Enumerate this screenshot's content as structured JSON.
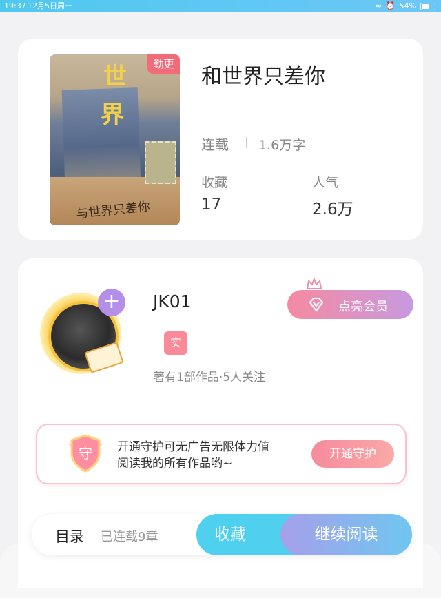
{
  "status_bar": {
    "time": "19:37",
    "date": "12月5日周一",
    "battery": "54%"
  },
  "book": {
    "badge": "勤更",
    "cover_lines": {
      "title_a": "世",
      "title_b": "界",
      "bottom_text": "与世界只差你"
    },
    "title": "和世界只差你",
    "status": "连载",
    "words": "1.6万字",
    "stats": [
      {
        "label": "收藏",
        "value": "17"
      },
      {
        "label": "人气",
        "value": "2.6万"
      }
    ]
  },
  "author": {
    "name": "JK01",
    "verify_badge": "实",
    "meta": "著有1部作品·5人关注",
    "vip_button": "点亮会员"
  },
  "guard": {
    "shield_char": "守",
    "line1": "开通守护可无广告无限体力值",
    "line2": "阅读我的所有作品哟~",
    "button": "开通守护"
  },
  "bottom_bar": {
    "toc": "目录",
    "chapters": "已连载9章",
    "favorite": "收藏",
    "continue": "继续阅读"
  },
  "colors": {
    "accent_pink": "#f26b78",
    "accent_blue": "#4fd0ee",
    "accent_purple": "#b48fe8"
  }
}
